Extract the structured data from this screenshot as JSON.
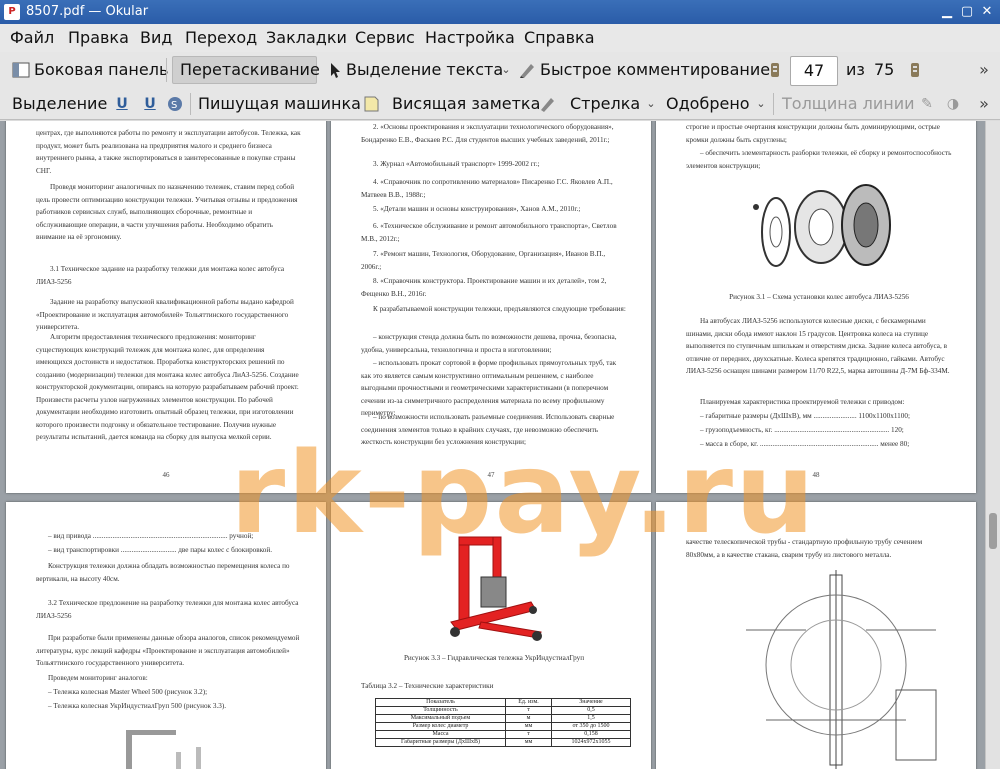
{
  "window": {
    "title": "8507.pdf — Okular",
    "app_icon": "okular-icon"
  },
  "menu": [
    "Файл",
    "Правка",
    "Вид",
    "Переход",
    "Закладки",
    "Сервис",
    "Настройка",
    "Справка"
  ],
  "toolbar1": {
    "sidebar": "Боковая панель",
    "drag": "Перетаскивание",
    "text_select": "Выделение текста",
    "quick_comment": "Быстрое комментирование",
    "page_current": "47",
    "page_of": "из",
    "page_total": "75"
  },
  "toolbar2": {
    "selection": "Выделение",
    "typewriter": "Пишущая машинка",
    "sticky_note": "Висящая заметка",
    "arrow": "Стрелка",
    "approved": "Одобрено",
    "line_width": "Толщина линии"
  },
  "pages": {
    "p46": {
      "number": "46",
      "paragraphs": [
        "центрах, где выполняются работы по ремонту и эксплуатации автобусов. Тележка, как продукт, может быть реализована на предприятия малого и среднего бизнеса внутреннего рынка, а также экспортироваться в заинтересованные в покупке страны СНГ.",
        "Проведя мониторинг аналогичных по назначению тележек, ставим перед собой цель провести оптимизацию конструкции тележки. Учитывая отзывы и предложения работников сервисных служб, выполняющих сборочные, ремонтные и обслуживающие операции, в части улучшения работы. Необходимо обратить внимание на её эргономику.",
        "3.1 Техническое задание на разработку тележки для монтажа колес автобуса ЛИАЗ-5256",
        "Задание на разработку выпускной квалификационной работы выдано кафедрой «Проектирование и эксплуатация автомобилей» Тольяттинского государственного университета.",
        "Алгоритм предоставления технического предложения: мониторинг существующих конструкций тележек для монтажа колес, для определения имеющихся достоинств и недостатков. Проработка конструкторских решений по созданию (модернизации) тележки для монтажа колес автобуса ЛиАЗ-5256. Создание конструкторской документации, опираясь на которую разрабатываем рабочий проект. Произвести расчеты узлов нагруженных элементов конструкции. По рабочей документации необходимо изготовить опытный образец тележки, при изготовлении которого произвести подгонку и обязательное тестирование. Получив нужные результаты испытаний, дается команда на сборку для выпуска мелкой серии."
      ]
    },
    "p47": {
      "number": "47",
      "paragraphs": [
        "2. «Основы проектирования и эксплуатации технологического оборудования», Бондаренко Е.В., Фаскаев Р.С. Для студентов высших учебных заведений, 2011г.;",
        "3. Журнал «Автомобильный транспорт» 1999-2002 гг.;",
        "4. «Справочник по сопротивлению материалов» Писаренко Г.С. Яковлев А.П., Матвеев В.В., 1988г.;",
        "5. «Детали машин и основы конструирования», Ханов А.М., 2010г.;",
        "6. «Техническое обслуживание и ремонт автомобильного транспорта», Светлов М.В., 2012г.;",
        "7. «Ремонт машин, Технология, Оборудование, Организация», Иванов В.П., 2006г.;",
        "8. «Справочник конструктора. Проектирование машин и их деталей», том 2, Фещенко В.Н., 2016г.",
        "К разрабатываемой конструкции тележки, предъявляются следующие требования:",
        "– конструкция стенда должна быть по возможности дешева, прочна, безопасна, удобна, универсальна, технологична и проста в изготовлении;",
        "– использовать прокат сортовой в форме профильных прямоугольных труб, так как это является самым конструктивно оптимальным решением, с наиболее выгодными прочностными и геометрическими характеристиками (в поперечном сечении из-за симметричного распределения материала по всему профильному периметру;",
        "– по возможности использовать разъемные соединения. Использовать сварные соединения элементов только в крайних случаях, где невозможно обеспечить жесткость конструкции без усложнения конструкции;"
      ]
    },
    "p48": {
      "number": "48",
      "paragraphs": [
        "строгие и простые очертания конструкции должны быть доминирующими, острые кромки должны быть скруглены;",
        "– обеспечить элементарность разборки тележки, её сборку и ремонтоспособность элементов конструкции;"
      ],
      "caption": "Рисунок 3.1 – Схема установки колес автобуса ЛИАЗ-5256",
      "paragraphs2": [
        "На автобусах ЛИАЗ-5256 используются колесные диски, с бескамерными шинами, диски обода имеют наклон 15 градусов. Центровка колеса на ступице выполняется по ступичным шпилькам и отверстиям диска. Задние колеса автобуса, в отличие от передних, двухскатные. Колеса крепятся традиционно, гайками. Автобус ЛИАЗ-5256 оснащен шинами размером 11/70 R22,5, марка автошины Д-7М Бф-334М.",
        "Планируемая характеристика проектируемой тележки с приводом:",
        "– габаритные размеры (ДхШхВ), мм ........................ 1100х1100х1100;",
        "– грузоподъемность, кг. ................................................................ 120;",
        "– масса в сборе, кг. .................................................................. менее 80;"
      ]
    },
    "p49": {
      "paragraphs": [
        "– вид привода ........................................................................... ручной;",
        "– вид транспортировки ............................... две пары колес с блокировкой.",
        "Конструкция тележки должна обладать возможностью перемещения колеса по вертикали, на высоту 40см.",
        "3.2 Техническое предложение на разработку тележки для монтажа колес автобуса ЛИАЗ-5256",
        "При разработке были применены данные обзора аналогов, список рекомендуемой литературы, курс лекций кафедры «Проектирование и эксплуатация автомобилей» Тольяттинского государственного университета.",
        "Проведем мониторинг аналогов:",
        "– Тележка колесная Master Wheel 500 (рисунок 3.2);",
        "– Тележка колесная УкрИндустиалГруп 500 (рисунок 3.3)."
      ]
    },
    "p50": {
      "caption": "Рисунок 3.3 – Гидравлическая тележка УкрИндустиалГруп",
      "table_title": "Таблица 3.2 – Технические характеристики",
      "table_headers": [
        "Показатель",
        "Ед. изм.",
        "Значение"
      ],
      "table_rows": [
        [
          "Толщинность",
          "т",
          "0,5"
        ],
        [
          "Максимальный подъем",
          "м",
          "1,5"
        ],
        [
          "Размер колес диаметр",
          "мм",
          "от 350 до 1500"
        ],
        [
          "Масса",
          "т",
          "0,158"
        ],
        [
          "Габаритные размеры (ДхШхВ)",
          "мм",
          "1024х972х1055"
        ]
      ]
    },
    "p51": {
      "paragraphs": [
        "качестве телескопической трубы - стандартную профильную трубу сечением 80х80мм, а в качестве стакана, сварим трубу из листового металла."
      ]
    }
  },
  "watermark": "rk-pay.ru",
  "colors": {
    "titlebar": "#2a5ca8",
    "trolley": "#e32222",
    "watermark": "#f09628"
  }
}
